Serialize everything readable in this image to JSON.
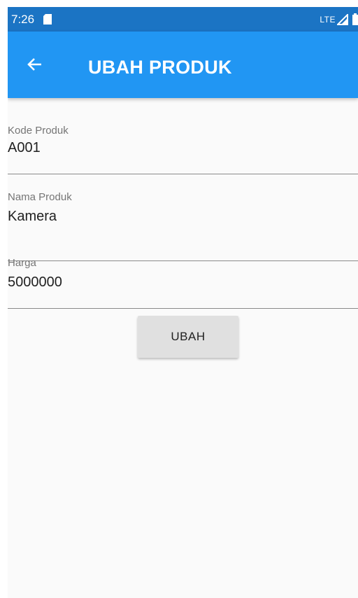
{
  "status_bar": {
    "time": "7:26",
    "network_label": "LTE",
    "background_color": "#1b74c4",
    "icons": [
      "sd-card-icon",
      "signal-icon",
      "battery-icon"
    ]
  },
  "app_bar": {
    "title": "UBAH PRODUK",
    "back_icon": "arrow-left-icon",
    "background_color": "#2196f3"
  },
  "form": {
    "fields": [
      {
        "label": "Kode Produk",
        "value": "A001"
      },
      {
        "label": "Nama Produk",
        "value": "Kamera"
      },
      {
        "label": "Harga",
        "value": "5000000"
      }
    ],
    "submit_label": "UBAH"
  }
}
